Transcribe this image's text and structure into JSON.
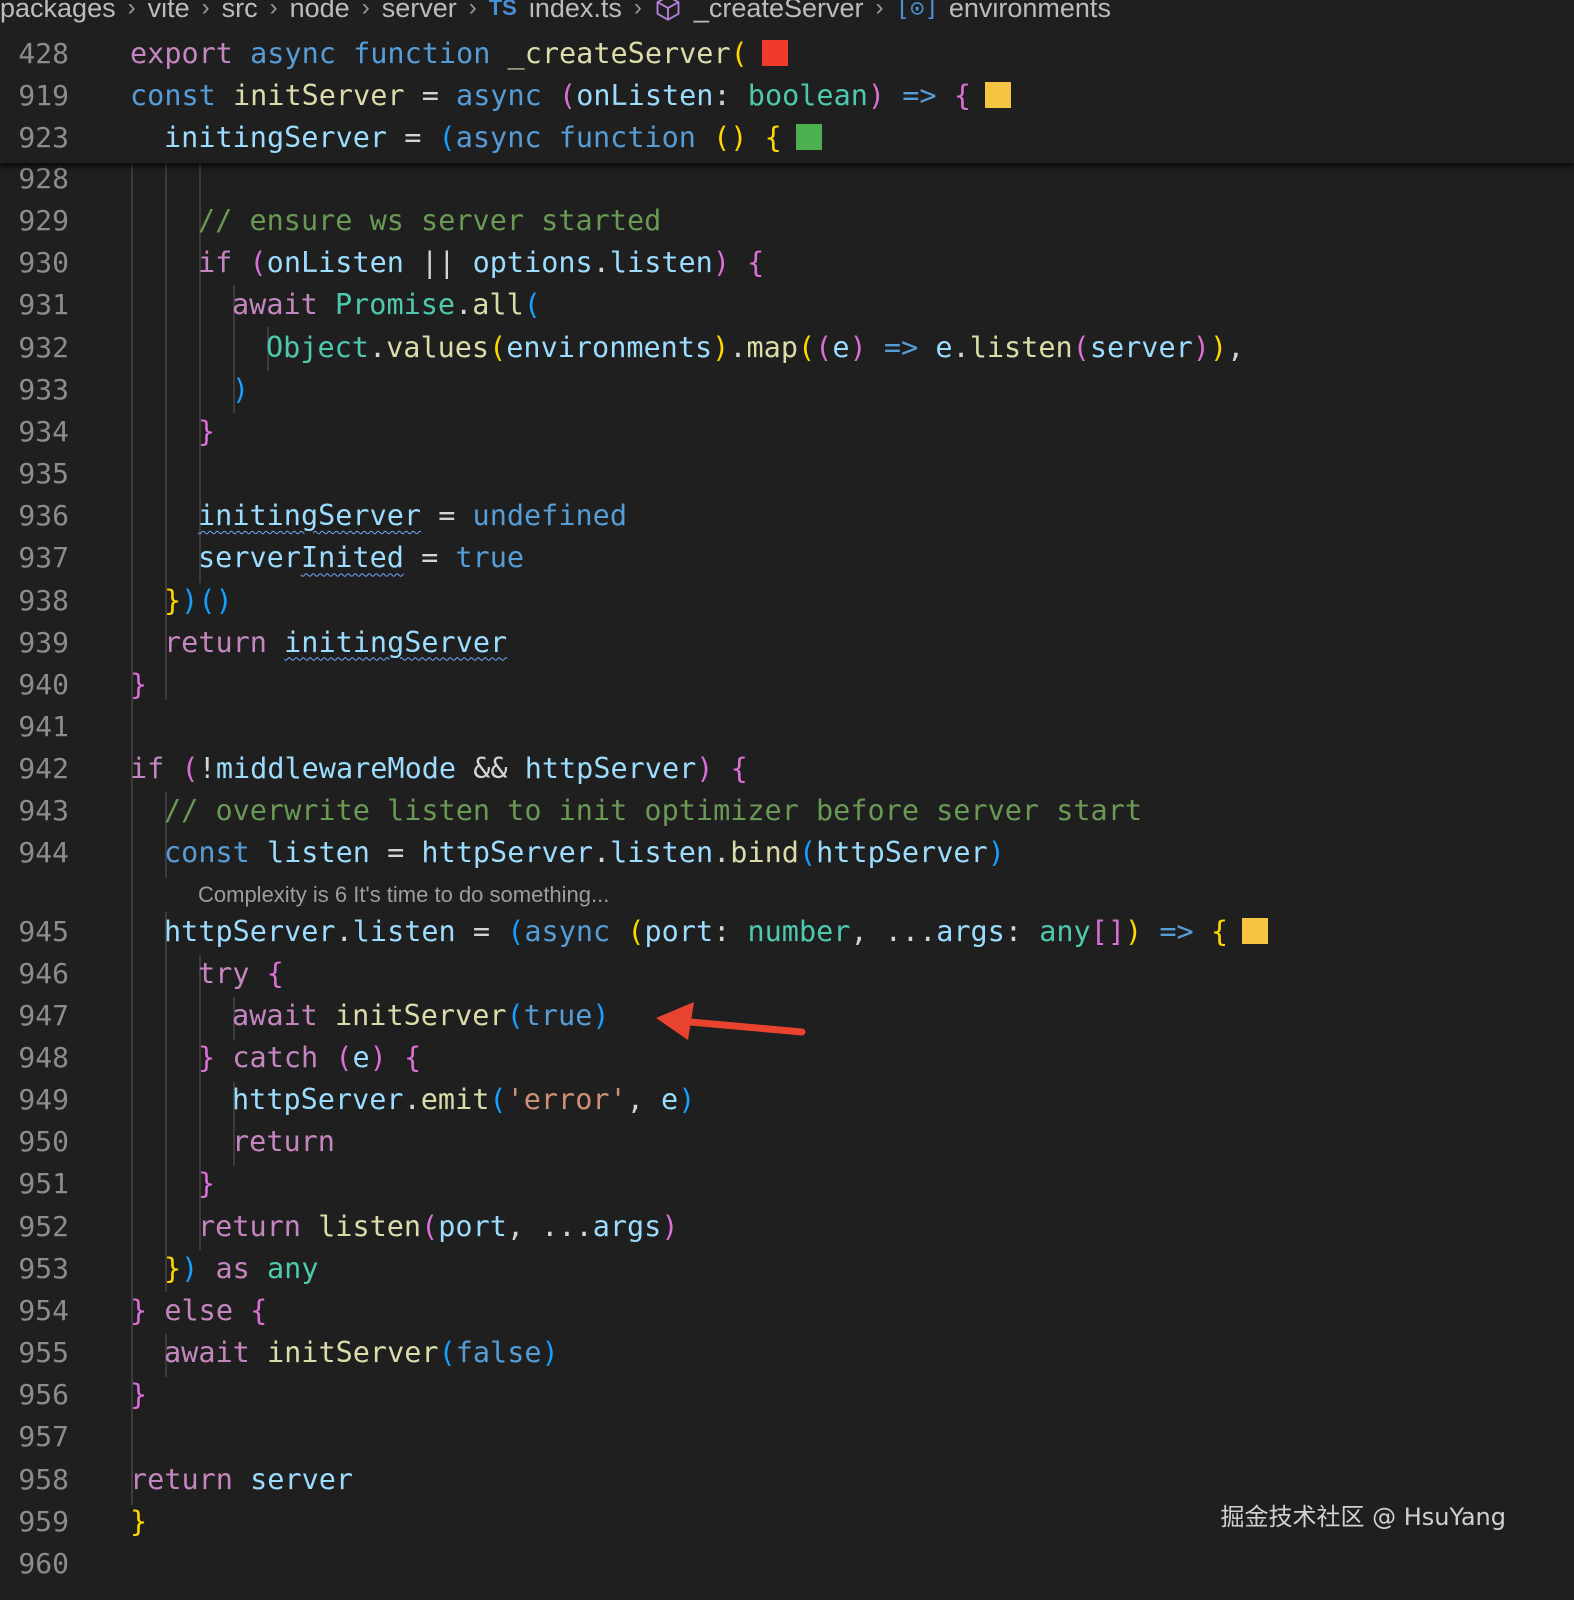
{
  "breadcrumb": {
    "items": [
      "packages",
      "vite",
      "src",
      "node",
      "server",
      "index.ts",
      "_createServer",
      "environments"
    ],
    "ts_badge": "TS",
    "env_badge": "[⊙]"
  },
  "colors": {
    "background": "#1f1f1f",
    "complexity_red": "#f03a2e",
    "complexity_yellow": "#f5c542",
    "complexity_green": "#4caf50",
    "annotation_arrow": "#e8432e"
  },
  "sticky_lines": [
    {
      "num": "428",
      "indent": 0,
      "tokens": [
        [
          "k",
          "export"
        ],
        [
          "p",
          " "
        ],
        [
          "sk",
          "async"
        ],
        [
          "p",
          " "
        ],
        [
          "sk",
          "function"
        ],
        [
          "p",
          " "
        ],
        [
          "fn",
          "_createServer"
        ],
        [
          "b1",
          "("
        ]
      ],
      "marker": "red"
    },
    {
      "num": "919",
      "indent": 1,
      "tokens": [
        [
          "sk",
          "const"
        ],
        [
          "p",
          " "
        ],
        [
          "fn",
          "initServer"
        ],
        [
          "p",
          " = "
        ],
        [
          "sk",
          "async"
        ],
        [
          "p",
          " "
        ],
        [
          "b2",
          "("
        ],
        [
          "v",
          "onListen"
        ],
        [
          "p",
          ": "
        ],
        [
          "ty",
          "boolean"
        ],
        [
          "b2",
          ")"
        ],
        [
          "p",
          " "
        ],
        [
          "sk",
          "=>"
        ],
        [
          "p",
          " "
        ],
        [
          "b2",
          "{"
        ]
      ],
      "marker": "yellow"
    },
    {
      "num": "923",
      "indent": 2,
      "tokens": [
        [
          "v",
          "initingServer"
        ],
        [
          "p",
          " = "
        ],
        [
          "b3",
          "("
        ],
        [
          "sk",
          "async"
        ],
        [
          "p",
          " "
        ],
        [
          "sk",
          "function"
        ],
        [
          "p",
          " "
        ],
        [
          "b1",
          "()"
        ],
        [
          "p",
          " "
        ],
        [
          "b1",
          "{"
        ]
      ],
      "marker": "green"
    }
  ],
  "code_lines": [
    {
      "num": "928",
      "indent": 0,
      "tokens": []
    },
    {
      "num": "929",
      "indent": 3,
      "tokens": [
        [
          "cm",
          "// ensure ws server started"
        ]
      ]
    },
    {
      "num": "930",
      "indent": 3,
      "tokens": [
        [
          "k",
          "if"
        ],
        [
          "p",
          " "
        ],
        [
          "b2",
          "("
        ],
        [
          "v",
          "onListen"
        ],
        [
          "p",
          " || "
        ],
        [
          "v",
          "options"
        ],
        [
          "p",
          "."
        ],
        [
          "v",
          "listen"
        ],
        [
          "b2",
          ")"
        ],
        [
          "p",
          " "
        ],
        [
          "b2",
          "{"
        ]
      ]
    },
    {
      "num": "931",
      "indent": 4,
      "tokens": [
        [
          "k",
          "await"
        ],
        [
          "p",
          " "
        ],
        [
          "ty",
          "Promise"
        ],
        [
          "p",
          "."
        ],
        [
          "fn",
          "all"
        ],
        [
          "b3",
          "("
        ]
      ]
    },
    {
      "num": "932",
      "indent": 5,
      "tokens": [
        [
          "ty",
          "Object"
        ],
        [
          "p",
          "."
        ],
        [
          "fn",
          "values"
        ],
        [
          "b1",
          "("
        ],
        [
          "v",
          "environments"
        ],
        [
          "b1",
          ")"
        ],
        [
          "p",
          "."
        ],
        [
          "fn",
          "map"
        ],
        [
          "b1",
          "("
        ],
        [
          "b2",
          "("
        ],
        [
          "v",
          "e"
        ],
        [
          "b2",
          ")"
        ],
        [
          "p",
          " "
        ],
        [
          "sk",
          "=>"
        ],
        [
          "p",
          " "
        ],
        [
          "v",
          "e"
        ],
        [
          "p",
          "."
        ],
        [
          "fn",
          "listen"
        ],
        [
          "b2",
          "("
        ],
        [
          "v",
          "server"
        ],
        [
          "b2",
          ")"
        ],
        [
          "b1",
          ")"
        ],
        [
          "p",
          ","
        ]
      ]
    },
    {
      "num": "933",
      "indent": 4,
      "tokens": [
        [
          "b3",
          ")"
        ]
      ]
    },
    {
      "num": "934",
      "indent": 3,
      "tokens": [
        [
          "b2",
          "}"
        ]
      ]
    },
    {
      "num": "935",
      "indent": 0,
      "tokens": []
    },
    {
      "num": "936",
      "indent": 3,
      "tokens": [
        [
          "vu",
          "initingServer"
        ],
        [
          "p",
          " = "
        ],
        [
          "sk",
          "undefined"
        ]
      ]
    },
    {
      "num": "937",
      "indent": 3,
      "tokens": [
        [
          "v",
          "server"
        ],
        [
          "vu",
          "Inited"
        ],
        [
          "p",
          " = "
        ],
        [
          "sk",
          "true"
        ]
      ]
    },
    {
      "num": "938",
      "indent": 2,
      "tokens": [
        [
          "b1",
          "}"
        ],
        [
          "b3",
          ")"
        ],
        [
          "b3",
          "()"
        ]
      ]
    },
    {
      "num": "939",
      "indent": 2,
      "tokens": [
        [
          "k",
          "return"
        ],
        [
          "p",
          " "
        ],
        [
          "vu",
          "initingServer"
        ]
      ]
    },
    {
      "num": "940",
      "indent": 1,
      "tokens": [
        [
          "b2",
          "}"
        ]
      ]
    },
    {
      "num": "941",
      "indent": 0,
      "tokens": []
    },
    {
      "num": "942",
      "indent": 1,
      "tokens": [
        [
          "k",
          "if"
        ],
        [
          "p",
          " "
        ],
        [
          "b2",
          "("
        ],
        [
          "p",
          "!"
        ],
        [
          "v",
          "middlewareMode"
        ],
        [
          "p",
          " && "
        ],
        [
          "v",
          "httpServer"
        ],
        [
          "b2",
          ")"
        ],
        [
          "p",
          " "
        ],
        [
          "b2",
          "{"
        ]
      ]
    },
    {
      "num": "943",
      "indent": 2,
      "tokens": [
        [
          "cm",
          "// overwrite listen to init optimizer before server start"
        ]
      ]
    },
    {
      "num": "944",
      "indent": 2,
      "tokens": [
        [
          "sk",
          "const"
        ],
        [
          "p",
          " "
        ],
        [
          "v",
          "listen"
        ],
        [
          "p",
          " = "
        ],
        [
          "v",
          "httpServer"
        ],
        [
          "p",
          "."
        ],
        [
          "v",
          "listen"
        ],
        [
          "p",
          "."
        ],
        [
          "fn",
          "bind"
        ],
        [
          "b3",
          "("
        ],
        [
          "v",
          "httpServer"
        ],
        [
          "b3",
          ")"
        ]
      ]
    },
    {
      "num": "945",
      "indent": 2,
      "tokens": [
        [
          "v",
          "httpServer"
        ],
        [
          "p",
          "."
        ],
        [
          "v",
          "listen"
        ],
        [
          "p",
          " = "
        ],
        [
          "b3",
          "("
        ],
        [
          "sk",
          "async"
        ],
        [
          "p",
          " "
        ],
        [
          "b1",
          "("
        ],
        [
          "v",
          "port"
        ],
        [
          "p",
          ": "
        ],
        [
          "ty",
          "number"
        ],
        [
          "p",
          ", ..."
        ],
        [
          "v",
          "args"
        ],
        [
          "p",
          ": "
        ],
        [
          "ty",
          "any"
        ],
        [
          "b2",
          "[]"
        ],
        [
          "b1",
          ")"
        ],
        [
          "p",
          " "
        ],
        [
          "sk",
          "=>"
        ],
        [
          "p",
          " "
        ],
        [
          "b1",
          "{"
        ]
      ],
      "marker": "yellow"
    },
    {
      "num": "946",
      "indent": 3,
      "tokens": [
        [
          "k",
          "try"
        ],
        [
          "p",
          " "
        ],
        [
          "b2",
          "{"
        ]
      ]
    },
    {
      "num": "947",
      "indent": 4,
      "tokens": [
        [
          "k",
          "await"
        ],
        [
          "p",
          " "
        ],
        [
          "fn",
          "initServer"
        ],
        [
          "b3",
          "("
        ],
        [
          "sk",
          "true"
        ],
        [
          "b3",
          ")"
        ]
      ]
    },
    {
      "num": "948",
      "indent": 3,
      "tokens": [
        [
          "b2",
          "}"
        ],
        [
          "p",
          " "
        ],
        [
          "k",
          "catch"
        ],
        [
          "p",
          " "
        ],
        [
          "b2",
          "("
        ],
        [
          "v",
          "e"
        ],
        [
          "b2",
          ")"
        ],
        [
          "p",
          " "
        ],
        [
          "b2",
          "{"
        ]
      ]
    },
    {
      "num": "949",
      "indent": 4,
      "tokens": [
        [
          "v",
          "httpServer"
        ],
        [
          "p",
          "."
        ],
        [
          "fn",
          "emit"
        ],
        [
          "b3",
          "("
        ],
        [
          "st",
          "'error'"
        ],
        [
          "p",
          ", "
        ],
        [
          "v",
          "e"
        ],
        [
          "b3",
          ")"
        ]
      ]
    },
    {
      "num": "950",
      "indent": 4,
      "tokens": [
        [
          "k",
          "return"
        ]
      ]
    },
    {
      "num": "951",
      "indent": 3,
      "tokens": [
        [
          "b2",
          "}"
        ]
      ]
    },
    {
      "num": "952",
      "indent": 3,
      "tokens": [
        [
          "k",
          "return"
        ],
        [
          "p",
          " "
        ],
        [
          "fn",
          "listen"
        ],
        [
          "b2",
          "("
        ],
        [
          "v",
          "port"
        ],
        [
          "p",
          ", ..."
        ],
        [
          "v",
          "args"
        ],
        [
          "b2",
          ")"
        ]
      ]
    },
    {
      "num": "953",
      "indent": 2,
      "tokens": [
        [
          "b1",
          "}"
        ],
        [
          "b3",
          ")"
        ],
        [
          "p",
          " "
        ],
        [
          "k",
          "as"
        ],
        [
          "p",
          " "
        ],
        [
          "ty",
          "any"
        ]
      ]
    },
    {
      "num": "954",
      "indent": 1,
      "tokens": [
        [
          "b2",
          "}"
        ],
        [
          "p",
          " "
        ],
        [
          "k",
          "else"
        ],
        [
          "p",
          " "
        ],
        [
          "b2",
          "{"
        ]
      ]
    },
    {
      "num": "955",
      "indent": 2,
      "tokens": [
        [
          "k",
          "await"
        ],
        [
          "p",
          " "
        ],
        [
          "fn",
          "initServer"
        ],
        [
          "b3",
          "("
        ],
        [
          "sk",
          "false"
        ],
        [
          "b3",
          ")"
        ]
      ]
    },
    {
      "num": "956",
      "indent": 1,
      "tokens": [
        [
          "b2",
          "}"
        ]
      ]
    },
    {
      "num": "957",
      "indent": 0,
      "tokens": []
    },
    {
      "num": "958",
      "indent": 1,
      "tokens": [
        [
          "k",
          "return"
        ],
        [
          "p",
          " "
        ],
        [
          "v",
          "server"
        ]
      ]
    },
    {
      "num": "959",
      "indent": 0,
      "tokens": [
        [
          "b1",
          "}"
        ]
      ]
    },
    {
      "num": "960",
      "indent": 0,
      "tokens": []
    }
  ],
  "code_lens": "Complexity is 6 It's time to do something...",
  "watermark": "掘金技术社区 @ HsuYang"
}
